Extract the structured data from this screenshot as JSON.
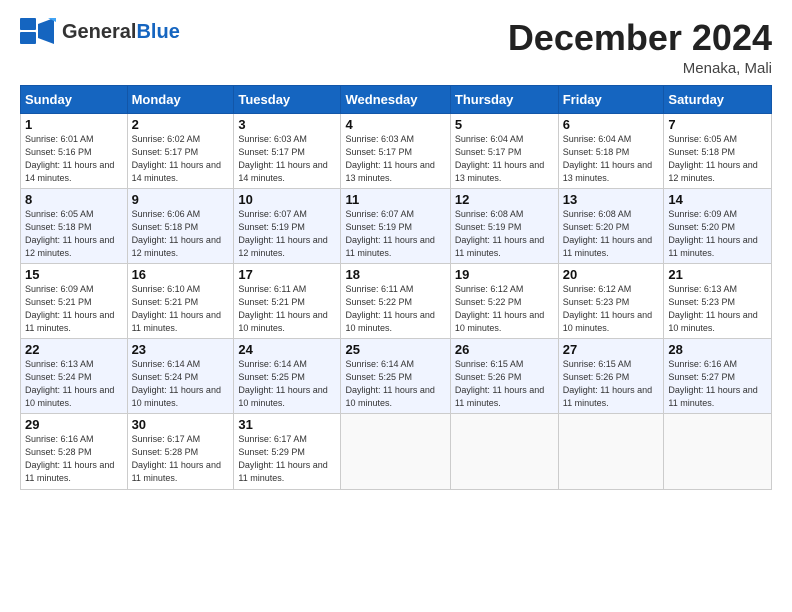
{
  "logo": {
    "general": "General",
    "blue": "Blue"
  },
  "title": "December 2024",
  "location": "Menaka, Mali",
  "days_header": [
    "Sunday",
    "Monday",
    "Tuesday",
    "Wednesday",
    "Thursday",
    "Friday",
    "Saturday"
  ],
  "weeks": [
    [
      {
        "day": "1",
        "sunrise": "6:01 AM",
        "sunset": "5:16 PM",
        "daylight": "11 hours and 14 minutes."
      },
      {
        "day": "2",
        "sunrise": "6:02 AM",
        "sunset": "5:17 PM",
        "daylight": "11 hours and 14 minutes."
      },
      {
        "day": "3",
        "sunrise": "6:03 AM",
        "sunset": "5:17 PM",
        "daylight": "11 hours and 14 minutes."
      },
      {
        "day": "4",
        "sunrise": "6:03 AM",
        "sunset": "5:17 PM",
        "daylight": "11 hours and 13 minutes."
      },
      {
        "day": "5",
        "sunrise": "6:04 AM",
        "sunset": "5:17 PM",
        "daylight": "11 hours and 13 minutes."
      },
      {
        "day": "6",
        "sunrise": "6:04 AM",
        "sunset": "5:18 PM",
        "daylight": "11 hours and 13 minutes."
      },
      {
        "day": "7",
        "sunrise": "6:05 AM",
        "sunset": "5:18 PM",
        "daylight": "11 hours and 12 minutes."
      }
    ],
    [
      {
        "day": "8",
        "sunrise": "6:05 AM",
        "sunset": "5:18 PM",
        "daylight": "11 hours and 12 minutes."
      },
      {
        "day": "9",
        "sunrise": "6:06 AM",
        "sunset": "5:18 PM",
        "daylight": "11 hours and 12 minutes."
      },
      {
        "day": "10",
        "sunrise": "6:07 AM",
        "sunset": "5:19 PM",
        "daylight": "11 hours and 12 minutes."
      },
      {
        "day": "11",
        "sunrise": "6:07 AM",
        "sunset": "5:19 PM",
        "daylight": "11 hours and 11 minutes."
      },
      {
        "day": "12",
        "sunrise": "6:08 AM",
        "sunset": "5:19 PM",
        "daylight": "11 hours and 11 minutes."
      },
      {
        "day": "13",
        "sunrise": "6:08 AM",
        "sunset": "5:20 PM",
        "daylight": "11 hours and 11 minutes."
      },
      {
        "day": "14",
        "sunrise": "6:09 AM",
        "sunset": "5:20 PM",
        "daylight": "11 hours and 11 minutes."
      }
    ],
    [
      {
        "day": "15",
        "sunrise": "6:09 AM",
        "sunset": "5:21 PM",
        "daylight": "11 hours and 11 minutes."
      },
      {
        "day": "16",
        "sunrise": "6:10 AM",
        "sunset": "5:21 PM",
        "daylight": "11 hours and 11 minutes."
      },
      {
        "day": "17",
        "sunrise": "6:11 AM",
        "sunset": "5:21 PM",
        "daylight": "11 hours and 10 minutes."
      },
      {
        "day": "18",
        "sunrise": "6:11 AM",
        "sunset": "5:22 PM",
        "daylight": "11 hours and 10 minutes."
      },
      {
        "day": "19",
        "sunrise": "6:12 AM",
        "sunset": "5:22 PM",
        "daylight": "11 hours and 10 minutes."
      },
      {
        "day": "20",
        "sunrise": "6:12 AM",
        "sunset": "5:23 PM",
        "daylight": "11 hours and 10 minutes."
      },
      {
        "day": "21",
        "sunrise": "6:13 AM",
        "sunset": "5:23 PM",
        "daylight": "11 hours and 10 minutes."
      }
    ],
    [
      {
        "day": "22",
        "sunrise": "6:13 AM",
        "sunset": "5:24 PM",
        "daylight": "11 hours and 10 minutes."
      },
      {
        "day": "23",
        "sunrise": "6:14 AM",
        "sunset": "5:24 PM",
        "daylight": "11 hours and 10 minutes."
      },
      {
        "day": "24",
        "sunrise": "6:14 AM",
        "sunset": "5:25 PM",
        "daylight": "11 hours and 10 minutes."
      },
      {
        "day": "25",
        "sunrise": "6:14 AM",
        "sunset": "5:25 PM",
        "daylight": "11 hours and 10 minutes."
      },
      {
        "day": "26",
        "sunrise": "6:15 AM",
        "sunset": "5:26 PM",
        "daylight": "11 hours and 11 minutes."
      },
      {
        "day": "27",
        "sunrise": "6:15 AM",
        "sunset": "5:26 PM",
        "daylight": "11 hours and 11 minutes."
      },
      {
        "day": "28",
        "sunrise": "6:16 AM",
        "sunset": "5:27 PM",
        "daylight": "11 hours and 11 minutes."
      }
    ],
    [
      {
        "day": "29",
        "sunrise": "6:16 AM",
        "sunset": "5:28 PM",
        "daylight": "11 hours and 11 minutes."
      },
      {
        "day": "30",
        "sunrise": "6:17 AM",
        "sunset": "5:28 PM",
        "daylight": "11 hours and 11 minutes."
      },
      {
        "day": "31",
        "sunrise": "6:17 AM",
        "sunset": "5:29 PM",
        "daylight": "11 hours and 11 minutes."
      },
      null,
      null,
      null,
      null
    ]
  ]
}
